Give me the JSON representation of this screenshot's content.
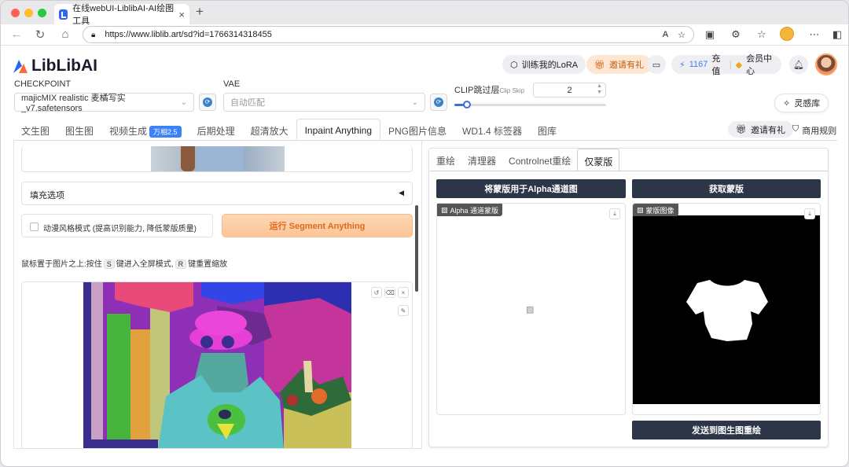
{
  "browser": {
    "tab_title": "在线webUI-LiblibAI-AI绘图工具",
    "url": "https://www.liblib.art/sd?id=1766314318455"
  },
  "header": {
    "logo_text": "LibLibAI",
    "train_lora": "训练我的LoRA",
    "invite": "邀请有礼",
    "credits": "1167",
    "recharge": "充值",
    "member": "会员中心"
  },
  "controls": {
    "checkpoint_label": "CHECKPOINT",
    "checkpoint_value": "majicMIX realistic 麦橘写实_v7.safetensors",
    "vae_label": "VAE",
    "vae_value": "自动匹配",
    "clip_label": "CLIP跳过层",
    "clip_sub": "Clip Skip",
    "clip_value": "2",
    "clip_slider_fraction": 0.08,
    "inspiration": "灵感库"
  },
  "tabs": [
    "文生图",
    "图生图",
    "视频生成",
    "后期处理",
    "超清放大",
    "Inpaint Anything",
    "PNG图片信息",
    "WD1.4 标签器",
    "图库"
  ],
  "video_badge": "万相2.5",
  "active_tab": "Inpaint Anything",
  "right_links": {
    "invite": "邀请有礼",
    "rules": "商用规则"
  },
  "left": {
    "fill_options": "填充选项",
    "anime_checkbox": "动漫风格模式 (提高识别能力, 降低蒙版质量)",
    "run_button": "运行 Segment Anything",
    "hint_pre": "鼠标置于图片之上:按住",
    "hint_key1": "S",
    "hint_mid": "键进入全屏模式,",
    "hint_key2": "R",
    "hint_post": "键重置缩放"
  },
  "subtabs": [
    "重绘",
    "清理器",
    "Controlnet重绘",
    "仅蒙版"
  ],
  "active_subtab": "仅蒙版",
  "right": {
    "alpha_button": "将蒙版用于Alpha通道图",
    "get_mask_button": "获取蒙版",
    "alpha_tag": "Alpha 通道蒙版",
    "mask_tag": "蒙版图像",
    "send_button": "发送到图生图重绘"
  }
}
